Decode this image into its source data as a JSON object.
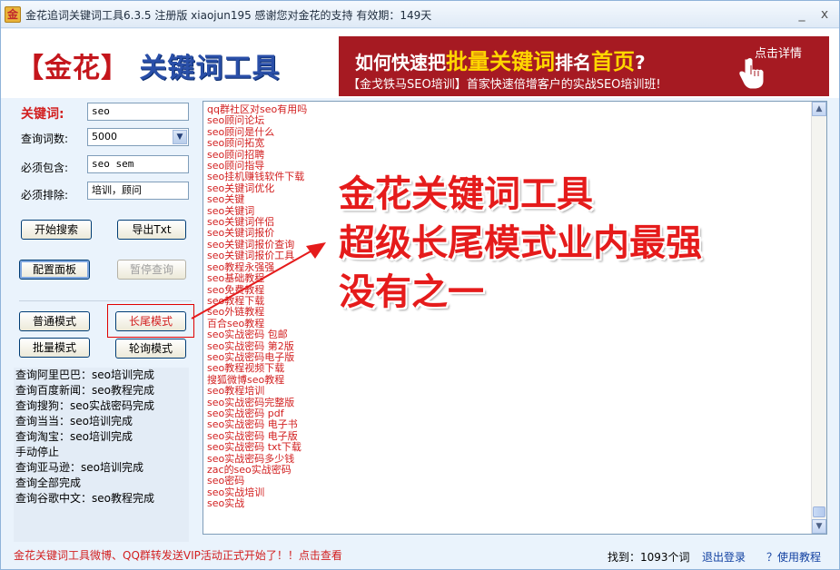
{
  "window": {
    "title": "金花追词关键词工具6.3.5  注册版 xiaojun195  感谢您对金花的支持 有效期：149天",
    "minimize": "_",
    "close": "x"
  },
  "header": {
    "logo_left_bracket": "【",
    "logo_name": "金花",
    "logo_right_bracket": "】",
    "logo_tool": "关键词工具",
    "banner": {
      "line1_a": "如何快速把",
      "line1_hl1": "批量关键词",
      "line1_b": "排名",
      "line1_hl2": "首页",
      "line1_c": "?",
      "line2": "【金戈铁马SEO培训】首家快速倍增客户的实战SEO培训班!",
      "cta": "点击详情"
    }
  },
  "form": {
    "keyword_label": "关键词:",
    "keyword_value": "seo",
    "count_label": "查询词数:",
    "count_value": "5000",
    "include_label": "必须包含:",
    "include_value": "seo sem",
    "exclude_label": "必须排除:",
    "exclude_value": "培训，顾问"
  },
  "buttons": {
    "start": "开始搜索",
    "export": "导出Txt",
    "config": "配置面板",
    "pause": "暂停查询",
    "normal_mode": "普通模式",
    "longtail_mode": "长尾模式",
    "batch_mode": "批量模式",
    "rotate_mode": "轮询模式"
  },
  "status_log": [
    "查询阿里巴巴：seo培训完成",
    "查询百度新闻：seo教程完成",
    "查询搜狗：seo实战密码完成",
    "查询当当：seo培训完成",
    "查询淘宝：seo培训完成",
    "手动停止",
    "查询亚马逊：seo培训完成",
    "查询全部完成",
    "查询谷歌中文：seo教程完成"
  ],
  "results": [
    "qq群社区对seo有用吗",
    "seo顾问论坛",
    "seo顾问是什么",
    "seo顾问拓宽",
    "seo顾问招聘",
    "seo顾问指导",
    "seo挂机赚钱软件下载",
    "seo关键词优化",
    "seo关键",
    "seo关键词",
    "seo关键词伴侣",
    "seo关键词报价",
    "seo关键词报价查询",
    "seo关键词报价工具",
    "seo教程永强强",
    "seo基础教程",
    "seo免费教程",
    "seo教程下载",
    "seo外链教程",
    "百合seo教程",
    "seo实战密码 包邮",
    "seo实战密码 第2版",
    "seo实战密码电子版",
    "seo教程视频下载",
    "搜狐微博seo教程",
    "seo教程培训",
    "seo实战密码完整版",
    "seo实战密码 pdf",
    "seo实战密码 电子书",
    "seo实战密码 电子版",
    "seo实战密码 txt下载",
    "seo实战密码多少钱",
    "zac的seo实战密码",
    "seo密码",
    "seo实战培训",
    "seo实战"
  ],
  "overlay": {
    "line1": "金花关键词工具",
    "line2": "超级长尾模式业内最强",
    "line3": "没有之一"
  },
  "footer": {
    "promo": "金花关键词工具微博、QQ群转发送VIP活动正式开始了！！点击查看",
    "found": "找到：1093个词",
    "logout": "退出登录",
    "help": "？使用教程"
  },
  "colors": {
    "accent_red": "#d21f1f",
    "banner_bg": "#a61a22",
    "window_bg": "#eaf3fc",
    "link_blue": "#1241a1"
  },
  "icons": {
    "app": "app-logo-icon",
    "hand": "hand-pointer-icon",
    "dropdown": "chevron-down-icon",
    "scroll_up": "scroll-up-arrow-icon",
    "scroll_down": "scroll-down-arrow-icon"
  }
}
